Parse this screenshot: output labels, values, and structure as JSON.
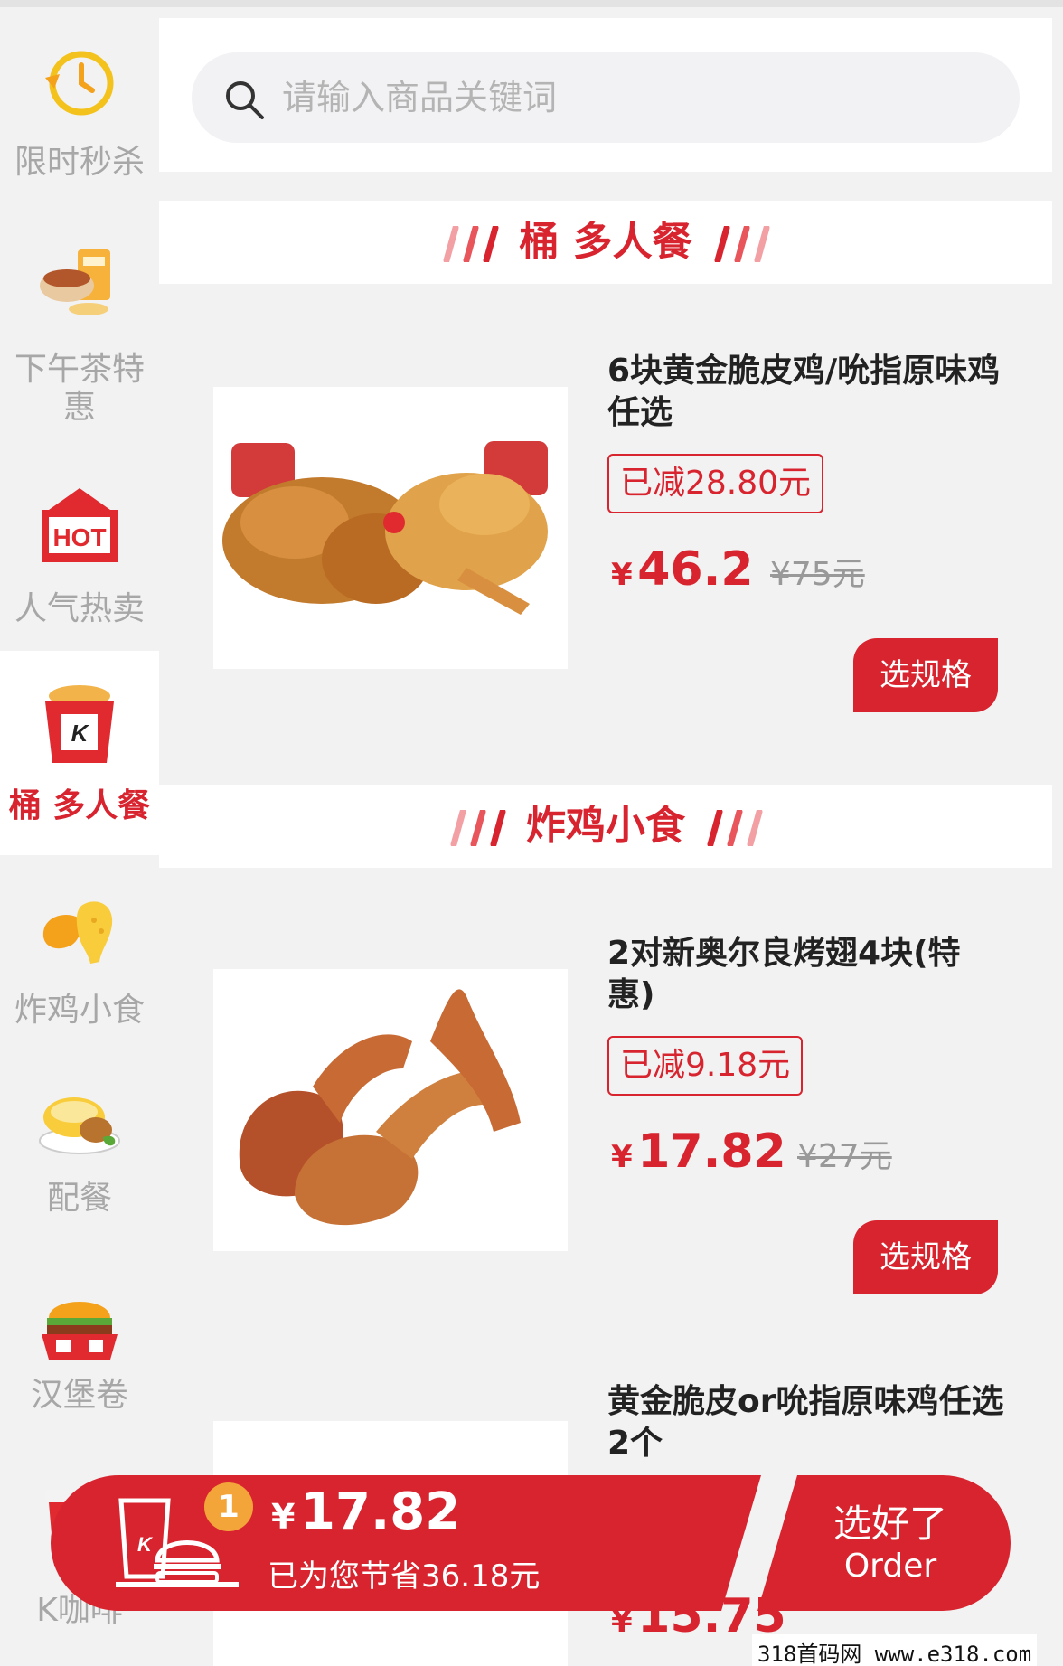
{
  "sidebar": {
    "items": [
      {
        "label": "限时秒杀",
        "icon": "clock-icon",
        "active": false
      },
      {
        "label": "下午茶特\n惠",
        "icon": "afternoon-tea-icon",
        "active": false
      },
      {
        "label": "人气热卖",
        "icon": "hot-icon",
        "active": false
      },
      {
        "label": "桶 多人餐",
        "icon": "bucket-icon",
        "active": true
      },
      {
        "label": "炸鸡小食",
        "icon": "fried-chicken-icon",
        "active": false
      },
      {
        "label": "配餐",
        "icon": "side-dish-icon",
        "active": false
      },
      {
        "label": "汉堡卷",
        "icon": "burger-icon",
        "active": false
      },
      {
        "label": "K咖啡",
        "icon": "coffee-cup-icon",
        "active": false
      }
    ]
  },
  "search": {
    "placeholder": "请输入商品关键词"
  },
  "sections": [
    {
      "title": "桶 多人餐",
      "products": [
        {
          "name": "6块黄金脆皮鸡/吮指原味鸡 任选",
          "discount": "已减28.80元",
          "price": "46.2",
          "original": "¥75元",
          "button": "选规格",
          "currency": "¥"
        }
      ]
    },
    {
      "title": "炸鸡小食",
      "products": [
        {
          "name": "2对新奥尔良烤翅4块(特惠)",
          "discount": "已减9.18元",
          "price": "17.82",
          "original": "¥27元",
          "button": "选规格",
          "currency": "¥"
        },
        {
          "name": "黄金脆皮or吮指原味鸡任选2个",
          "price": "15.75",
          "currency": "¥"
        }
      ]
    }
  ],
  "cart": {
    "count": "1",
    "currency": "¥",
    "total": "17.82",
    "saved": "已为您节省36.18元",
    "order_cn": "选好了",
    "order_en": "Order"
  },
  "watermark": "318首码网 www.e318.com",
  "colors": {
    "accent": "#d8242f",
    "badge": "#f3a53a"
  }
}
